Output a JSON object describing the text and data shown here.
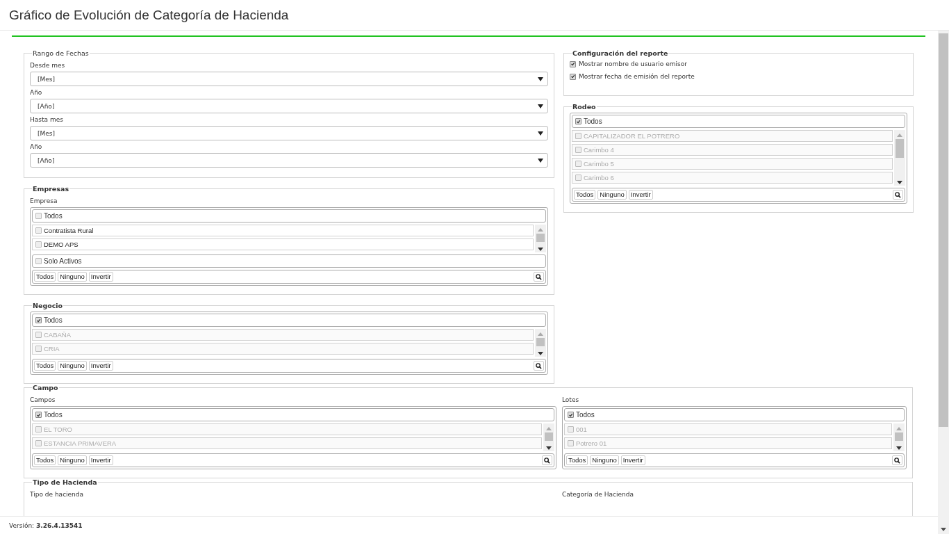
{
  "title": "Gráfico de Evolución de Categoría de Hacienda",
  "date_range": {
    "legend": "Rango de Fechas",
    "legend_bold": false,
    "fields": [
      {
        "label": "Desde mes",
        "value": "[Mes]"
      },
      {
        "label": "Año",
        "value": "[Año]"
      },
      {
        "label": "Hasta mes",
        "value": "[Mes]"
      },
      {
        "label": "Año",
        "value": "[Año]"
      }
    ]
  },
  "empresas": {
    "legend": "Empresas",
    "legend_bold": true,
    "label": "Empresa",
    "list": {
      "all": {
        "label": "Todos",
        "checked": false
      },
      "items": [
        {
          "label": "Contratista Rural",
          "checked": false,
          "disabled": false
        },
        {
          "label": "DEMO APS",
          "checked": false,
          "disabled": false
        }
      ],
      "extra": {
        "label": "Solo Activos",
        "checked": false
      },
      "buttons": [
        "Todos",
        "Ninguno",
        "Invertir"
      ]
    }
  },
  "negocio": {
    "legend": "Negocio",
    "legend_bold": true,
    "list": {
      "all": {
        "label": "Todos",
        "checked": true
      },
      "items": [
        {
          "label": "CABAÑA",
          "checked": false,
          "disabled": true
        },
        {
          "label": "CRIA",
          "checked": false,
          "disabled": true
        }
      ],
      "buttons": [
        "Todos",
        "Ninguno",
        "Invertir"
      ]
    }
  },
  "report_config": {
    "legend": "Configuración del reporte",
    "legend_bold": true,
    "options": [
      {
        "label": "Mostrar nombre de usuario emisor",
        "checked": true
      },
      {
        "label": "Mostrar fecha de emisión del reporte",
        "checked": true
      }
    ]
  },
  "rodeo": {
    "legend": "Rodeo",
    "legend_bold": true,
    "list": {
      "all": {
        "label": "Todos",
        "checked": true
      },
      "items": [
        {
          "label": "CAPITALIZADOR EL POTRERO",
          "checked": false,
          "disabled": true
        },
        {
          "label": "Carimbo 4",
          "checked": false,
          "disabled": true
        },
        {
          "label": "Carimbo 5",
          "checked": false,
          "disabled": true
        },
        {
          "label": "Carimbo 6",
          "checked": false,
          "disabled": true
        }
      ],
      "buttons": [
        "Todos",
        "Ninguno",
        "Invertir"
      ]
    }
  },
  "campo": {
    "legend": "Campo",
    "legend_bold": true,
    "columns": [
      {
        "label": "Campos",
        "list": {
          "all": {
            "label": "Todos",
            "checked": true
          },
          "items": [
            {
              "label": "EL TORO",
              "checked": false,
              "disabled": true
            },
            {
              "label": "ESTANCIA PRIMAVERA",
              "checked": false,
              "disabled": true
            }
          ],
          "buttons": [
            "Todos",
            "Ninguno",
            "Invertir"
          ]
        }
      },
      {
        "label": "Lotes",
        "list": {
          "all": {
            "label": "Todos",
            "checked": true
          },
          "items": [
            {
              "label": "001",
              "checked": false,
              "disabled": true
            },
            {
              "label": "Potrero 01",
              "checked": false,
              "disabled": true
            }
          ],
          "buttons": [
            "Todos",
            "Ninguno",
            "Invertir"
          ]
        }
      }
    ]
  },
  "tipo_hacienda": {
    "legend": "Tipo de Hacienda",
    "legend_bold": true,
    "columns": [
      {
        "label": "Tipo de hacienda"
      },
      {
        "label": "Categoría de Hacienda"
      }
    ]
  },
  "footer": {
    "version": "Versión: **3.26.4.13541**"
  }
}
